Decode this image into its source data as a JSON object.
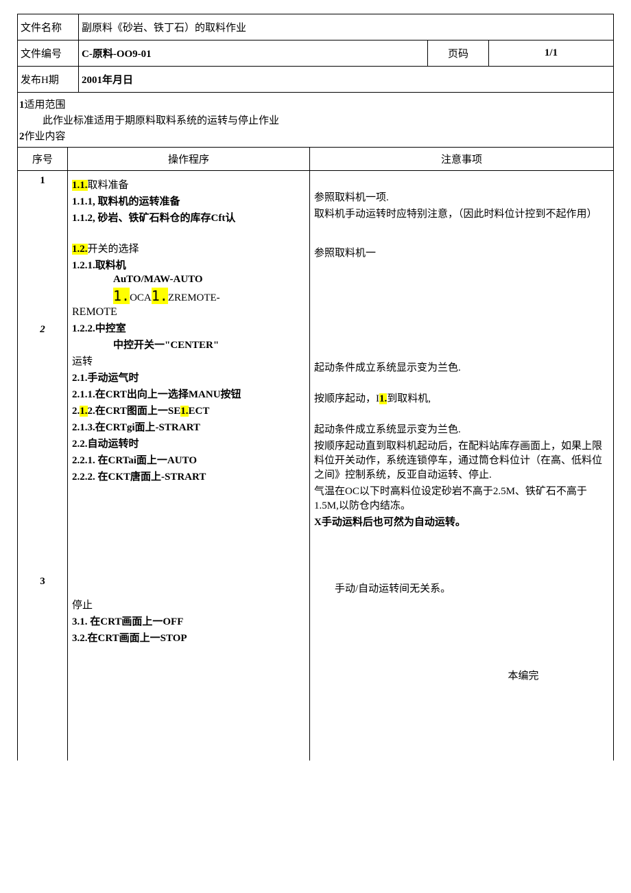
{
  "header": {
    "name_label": "文件名称",
    "name_value": "副原料《砂岩、铁丁石）的取料作业",
    "code_label": "文件编号",
    "code_value": "C-原料-OO9-01",
    "page_label": "页码",
    "page_value": "1/1",
    "date_label": "发布H期",
    "date_value": "2001年月日"
  },
  "scope": {
    "title_num": "1",
    "title": "适用范围",
    "body": "此作业标准适用于期原料取料系统的运转与停止作业"
  },
  "content": {
    "title_num": "2",
    "title": "作业内容"
  },
  "table_head": {
    "seq": "序号",
    "proc": "操作程序",
    "note": "注意事项"
  },
  "rows": {
    "r1_seq": "1",
    "r1_proc_11": "1.1.",
    "r1_proc_11_txt": "取料准备",
    "r1_proc_111": "1.1.1,    取料机的运转准备",
    "r1_proc_112": "1.1.2,    砂岩、铁矿石料仓的库存Cft认",
    "r1_proc_12": "1.2.",
    "r1_proc_12_txt": "开关的选择",
    "r1_proc_121": "1.2.1.取料机",
    "r1_proc_auto": "AuTO/MAW-AUTO",
    "r1_proc_loc_a": "1.",
    "r1_proc_loc_b": "OCA",
    "r1_proc_loc_c": "1.",
    "r1_proc_loc_d": "ZREMOTE-",
    "r1_proc_remote": "REMOTE",
    "r1_proc_122": "1.2.2.中控室",
    "r1_proc_center": "中控开关一\"CENTER\"",
    "r1_note_a": "参照取料机一项.",
    "r1_note_b": "取料机手动运转时应特别注意，（因此时料位计控到不起作用）",
    "r1_note_c": "参照取料机一",
    "r2_seq": "2",
    "r2_proc_run": "运转",
    "r2_proc_21": "2.1.手动运气时",
    "r2_proc_211": "2.1.1.在CRT出向上一选择MANU按钮",
    "r2_proc_212a": "2.",
    "r2_proc_212b": "1.",
    "r2_proc_212c": "2.在CRT图面上一SE",
    "r2_proc_212d": "1.",
    "r2_proc_212e": "ECT",
    "r2_proc_213": "2.1.3.在CRTgi面上-STRART",
    "r2_proc_22": "2.2.自动运转时",
    "r2_proc_221": "2.2.1.    在CRTai面上一AUTO",
    "r2_proc_222": "2.2.2.    在CKT唐面上-STRART",
    "r2_note_a": "起动条件成立系统显示变为兰色.",
    "r2_note_b": "按顺序起动，I",
    "r2_note_b_hl": "1.",
    "r2_note_b2": "到取料机,",
    "r2_note_c": "起动条件成立系统显示变为兰色.",
    "r2_note_d": "按顺序起动直到取料机起动后，在配料站库存画面上，如果上限料位开关动作，系统连锁停车，通过筒仓料位计（在高、低料位之间》控制系统，反亚自动运转、停止.",
    "r2_note_e": "气温在OC以下时高料位设定砂岩不高于2.5M、铁矿石不高于1.5M,以防仓内结冻。",
    "r2_note_f": "X手动运料后也可然为自动运转。",
    "r3_seq": "3",
    "r3_proc_stop": "停止",
    "r3_proc_31": "3.1. 在CRT画面上一OFF",
    "r3_proc_32": "3.2.在CRT画面上一STOP",
    "r3_note_a": "手动/自动运转间无关系。",
    "r3_note_end": "本编完"
  }
}
